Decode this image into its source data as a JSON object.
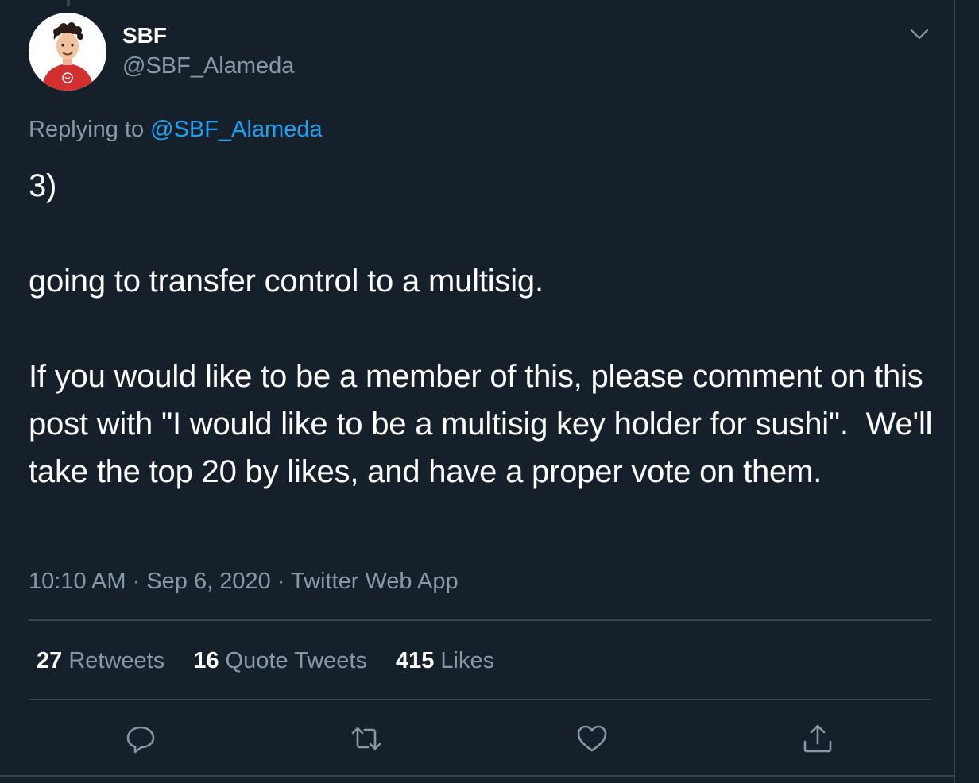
{
  "author": {
    "name": "SBF",
    "handle": "@SBF_Alameda"
  },
  "reply": {
    "prefix": "Replying to ",
    "mention": "@SBF_Alameda"
  },
  "tweet": {
    "text": "3)\n\ngoing to transfer control to a multisig.\n\nIf you would like to be a member of this, please comment on this post with \"I would like to be a multisig key holder for sushi\".  We'll take the top 20 by likes, and have a proper vote on them.",
    "time": "10:10 AM",
    "date": "Sep 6, 2020",
    "source": "Twitter Web App",
    "separator": " · "
  },
  "stats": {
    "retweets_count": "27",
    "retweets_label": " Retweets",
    "quotes_count": "16",
    "quotes_label": " Quote Tweets",
    "likes_count": "415",
    "likes_label": " Likes"
  },
  "icons": {
    "more": "chevron-down-icon",
    "reply": "reply-icon",
    "retweet": "retweet-icon",
    "like": "heart-icon",
    "share": "share-icon"
  },
  "colors": {
    "background": "#15202b",
    "border": "#38444d",
    "secondary_text": "#8899a6",
    "link": "#1da1f2",
    "avatar_shirt": "#d32f2f"
  }
}
